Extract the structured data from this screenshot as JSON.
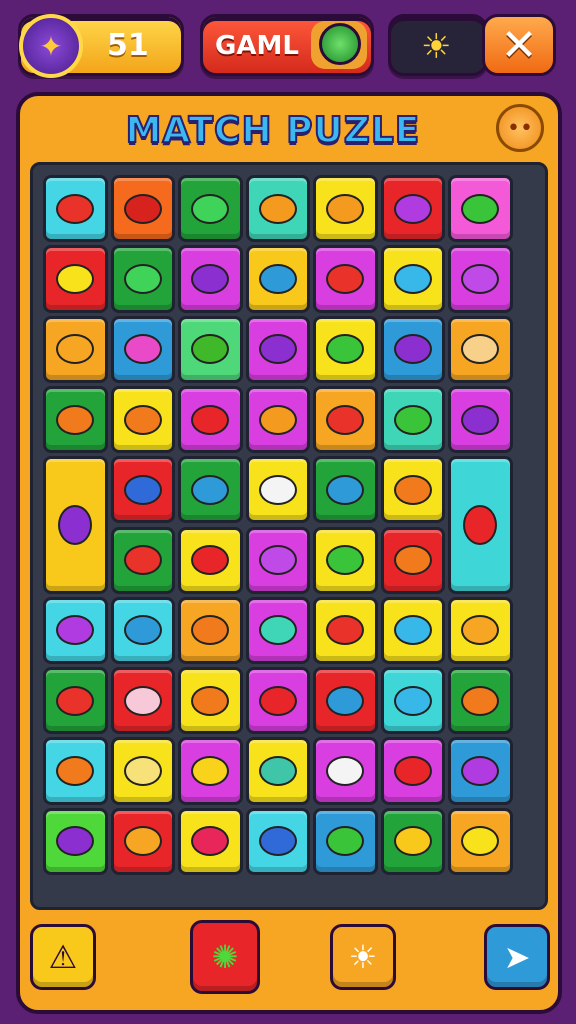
{
  "hud": {
    "coins": "51",
    "game_label": "GAML",
    "avatar_icon": "wizard-icon",
    "gem_icon": "green-gem-icon",
    "sun_icon": "sun-icon",
    "close_icon": "close-icon"
  },
  "panel": {
    "title": "MATCH PUZLE",
    "face_icon": "smiley-face-icon"
  },
  "board": {
    "columns": 7,
    "rows": 10,
    "tiles": [
      {
        "r": 0,
        "c": 0,
        "bg": "#45d6e6",
        "icon": "red-blob-icon",
        "ic": "#e8322a"
      },
      {
        "r": 0,
        "c": 1,
        "bg": "#f56a1c",
        "icon": "red-pin-icon",
        "ic": "#d8221e"
      },
      {
        "r": 0,
        "c": 2,
        "bg": "#22a43a",
        "icon": "green-pin-icon",
        "ic": "#3fd35a"
      },
      {
        "r": 0,
        "c": 3,
        "bg": "#3fd6b8",
        "icon": "orange-critter-icon",
        "ic": "#f39a1f"
      },
      {
        "r": 0,
        "c": 4,
        "bg": "#f8e21b",
        "icon": "orange-critter-icon",
        "ic": "#f39a1f"
      },
      {
        "r": 0,
        "c": 5,
        "bg": "#e8262a",
        "icon": "purple-bug-icon",
        "ic": "#b03be0"
      },
      {
        "r": 0,
        "c": 6,
        "bg": "#f45ad8",
        "icon": "green-lemon-icon",
        "ic": "#39c43a"
      },
      {
        "r": 1,
        "c": 0,
        "bg": "#e8262a",
        "icon": "yellow-lemon-icon",
        "ic": "#f8e21b"
      },
      {
        "r": 1,
        "c": 1,
        "bg": "#22a43a",
        "icon": "green-blob-icon",
        "ic": "#3fd35a"
      },
      {
        "r": 1,
        "c": 2,
        "bg": "#d83ee0",
        "icon": "purple-ball-icon",
        "ic": "#8b2fd0"
      },
      {
        "r": 1,
        "c": 3,
        "bg": "#f8c91b",
        "icon": "blue-ball-icon",
        "ic": "#2f9ad8"
      },
      {
        "r": 1,
        "c": 4,
        "bg": "#d83ee0",
        "icon": "red-critter-icon",
        "ic": "#e8322a"
      },
      {
        "r": 1,
        "c": 5,
        "bg": "#f8e21b",
        "icon": "blue-pin-icon",
        "ic": "#38b8e8"
      },
      {
        "r": 1,
        "c": 6,
        "bg": "#d83ee0",
        "icon": "purple-blob-icon",
        "ic": "#c04ae8"
      },
      {
        "r": 2,
        "c": 0,
        "bg": "#f6a623",
        "icon": "orange-face-icon",
        "ic": "#f6a623"
      },
      {
        "r": 2,
        "c": 1,
        "bg": "#2f9ad8",
        "icon": "pink-cookie-icon",
        "ic": "#e84ac8"
      },
      {
        "r": 2,
        "c": 2,
        "bg": "#4fd87a",
        "icon": "green-fruit-icon",
        "ic": "#3fb82a"
      },
      {
        "r": 2,
        "c": 3,
        "bg": "#d83ee0",
        "icon": "purple-ball-icon",
        "ic": "#8b2fd0"
      },
      {
        "r": 2,
        "c": 4,
        "bg": "#f8e21b",
        "icon": "green-pin-icon",
        "ic": "#39c43a"
      },
      {
        "r": 2,
        "c": 5,
        "bg": "#2f9ad8",
        "icon": "purple-ball-icon",
        "ic": "#8b2fd0"
      },
      {
        "r": 2,
        "c": 6,
        "bg": "#f6a623",
        "icon": "crab-icon",
        "ic": "#f7d08a"
      },
      {
        "r": 3,
        "c": 0,
        "bg": "#22a43a",
        "icon": "pin-pair-icon",
        "ic": "#f07a1c"
      },
      {
        "r": 3,
        "c": 1,
        "bg": "#f8e21b",
        "icon": "orange-ball-icon",
        "ic": "#f07a1c"
      },
      {
        "r": 3,
        "c": 2,
        "bg": "#d83ee0",
        "icon": "red-ball-icon",
        "ic": "#e8262a"
      },
      {
        "r": 3,
        "c": 3,
        "bg": "#d83ee0",
        "icon": "orange-critter-icon",
        "ic": "#f39a1f"
      },
      {
        "r": 3,
        "c": 4,
        "bg": "#f6a623",
        "icon": "red-pin-icon",
        "ic": "#e8322a"
      },
      {
        "r": 3,
        "c": 5,
        "bg": "#3fd6b8",
        "icon": "green-lemon-icon",
        "ic": "#39c43a"
      },
      {
        "r": 3,
        "c": 6,
        "bg": "#d83ee0",
        "icon": "purple-bug-icon",
        "ic": "#8b2fd0"
      },
      {
        "r": 4,
        "c": 0,
        "bg": "#f8c91b",
        "icon": "purple-skewer-icon",
        "ic": "#8b2fd0",
        "h": 2
      },
      {
        "r": 4,
        "c": 1,
        "bg": "#e8262a",
        "icon": "blue-ball-icon",
        "ic": "#2f6ad8"
      },
      {
        "r": 4,
        "c": 2,
        "bg": "#22a43a",
        "icon": "blue-face-icon",
        "ic": "#2f9ad8"
      },
      {
        "r": 4,
        "c": 3,
        "bg": "#f8e21b",
        "icon": "white-ghost-icon",
        "ic": "#f4f4f4"
      },
      {
        "r": 4,
        "c": 4,
        "bg": "#22a43a",
        "icon": "blue-face-icon",
        "ic": "#2f9ad8"
      },
      {
        "r": 4,
        "c": 5,
        "bg": "#f8e21b",
        "icon": "orange-ball-icon",
        "ic": "#f07a1c"
      },
      {
        "r": 4,
        "c": 6,
        "bg": "#3fd6d8",
        "icon": "fruit-stack-icon",
        "ic": "#e8262a",
        "h": 2
      },
      {
        "r": 5,
        "c": 1,
        "bg": "#22a43a",
        "icon": "red-spiky-icon",
        "ic": "#e8322a"
      },
      {
        "r": 5,
        "c": 2,
        "bg": "#f8e21b",
        "icon": "red-pin-icon",
        "ic": "#e8262a"
      },
      {
        "r": 5,
        "c": 3,
        "bg": "#d83ee0",
        "icon": "purple-face-icon",
        "ic": "#c04ae8"
      },
      {
        "r": 5,
        "c": 4,
        "bg": "#f8e21b",
        "icon": "green-ball-icon",
        "ic": "#39c43a"
      },
      {
        "r": 5,
        "c": 5,
        "bg": "#e8262a",
        "icon": "orange-pin-icon",
        "ic": "#f07a1c"
      },
      {
        "r": 6,
        "c": 0,
        "bg": "#45d6e6",
        "icon": "purple-lemon-icon",
        "ic": "#b03be0"
      },
      {
        "r": 6,
        "c": 1,
        "bg": "#45d6e6",
        "icon": "blue-pin-icon",
        "ic": "#2f9ad8"
      },
      {
        "r": 6,
        "c": 2,
        "bg": "#f6a623",
        "icon": "orange-ball-icon",
        "ic": "#f07a1c"
      },
      {
        "r": 6,
        "c": 3,
        "bg": "#d83ee0",
        "icon": "teal-pin-icon",
        "ic": "#3fd6b8"
      },
      {
        "r": 6,
        "c": 4,
        "bg": "#f8e21b",
        "icon": "red-critter-icon",
        "ic": "#e8322a"
      },
      {
        "r": 6,
        "c": 5,
        "bg": "#f8e21b",
        "icon": "blue-pen-icon",
        "ic": "#38b8e8"
      },
      {
        "r": 6,
        "c": 6,
        "bg": "#f8e21b",
        "icon": "paper-plane-icon",
        "ic": "#f6a623"
      },
      {
        "r": 7,
        "c": 0,
        "bg": "#22a43a",
        "icon": "red-fruit-icon",
        "ic": "#e8322a"
      },
      {
        "r": 7,
        "c": 1,
        "bg": "#e8262a",
        "icon": "pink-pin-icon",
        "ic": "#f7c8d8"
      },
      {
        "r": 7,
        "c": 2,
        "bg": "#f8e21b",
        "icon": "orange-ball-icon",
        "ic": "#f07a1c"
      },
      {
        "r": 7,
        "c": 3,
        "bg": "#d83ee0",
        "icon": "red-lips-icon",
        "ic": "#e8262a"
      },
      {
        "r": 7,
        "c": 4,
        "bg": "#e8262a",
        "icon": "blue-pin-icon",
        "ic": "#2f9ad8"
      },
      {
        "r": 7,
        "c": 5,
        "bg": "#3fd6d8",
        "icon": "blue-pin-icon",
        "ic": "#38b8e8"
      },
      {
        "r": 7,
        "c": 6,
        "bg": "#22a43a",
        "icon": "orange-pin-icon",
        "ic": "#f07a1c"
      },
      {
        "r": 8,
        "c": 0,
        "bg": "#45d6e6",
        "icon": "orange-star-icon",
        "ic": "#f07a1c"
      },
      {
        "r": 8,
        "c": 1,
        "bg": "#f8e21b",
        "icon": "sponge-icon",
        "ic": "#f7e27a"
      },
      {
        "r": 8,
        "c": 2,
        "bg": "#d83ee0",
        "icon": "yellow-pin-icon",
        "ic": "#f8d21b"
      },
      {
        "r": 8,
        "c": 3,
        "bg": "#f8e21b",
        "icon": "teal-pen-icon",
        "ic": "#3fc6a8"
      },
      {
        "r": 8,
        "c": 4,
        "bg": "#d83ee0",
        "icon": "white-pin-icon",
        "ic": "#f4f4f4"
      },
      {
        "r": 8,
        "c": 5,
        "bg": "#d83ee0",
        "icon": "red-pin-icon",
        "ic": "#e8262a"
      },
      {
        "r": 8,
        "c": 6,
        "bg": "#2f9ad8",
        "icon": "purple-lemon-icon",
        "ic": "#b03be0"
      },
      {
        "r": 9,
        "c": 0,
        "bg": "#4fd83a",
        "icon": "purple-skewer-icon",
        "ic": "#8b2fd0"
      },
      {
        "r": 9,
        "c": 1,
        "bg": "#e8262a",
        "icon": "pencil-icon",
        "ic": "#f6a623"
      },
      {
        "r": 9,
        "c": 2,
        "bg": "#f8e21b",
        "icon": "pink-pin-icon",
        "ic": "#e8265a"
      },
      {
        "r": 9,
        "c": 3,
        "bg": "#45d6e6",
        "icon": "blue-pin-icon",
        "ic": "#2f6ad8"
      },
      {
        "r": 9,
        "c": 4,
        "bg": "#2f9ad8",
        "icon": "green-face-icon",
        "ic": "#39c43a"
      },
      {
        "r": 9,
        "c": 5,
        "bg": "#22a43a",
        "icon": "yellow-pin-icon",
        "ic": "#f8c91b"
      },
      {
        "r": 9,
        "c": 6,
        "bg": "#f6a623",
        "icon": "yellow-flower-icon",
        "ic": "#f8e21b"
      }
    ]
  },
  "controls": [
    {
      "name": "hint-button",
      "icon": "warning-icon",
      "glyph": "⚠",
      "bg": "#f8c91b",
      "fg": "#2b0b38"
    },
    {
      "name": "booster-button",
      "icon": "green-virus-icon",
      "glyph": "✺",
      "bg": "#e8262a",
      "fg": "#4fd83a"
    },
    {
      "name": "shuffle-button",
      "icon": "white-sun-icon",
      "glyph": "☀",
      "bg": "#f6a623",
      "fg": "#ffffff"
    },
    {
      "name": "next-button",
      "icon": "arrow-cursor-icon",
      "glyph": "➤",
      "bg": "#2f9ad8",
      "fg": "#ffffff"
    }
  ]
}
